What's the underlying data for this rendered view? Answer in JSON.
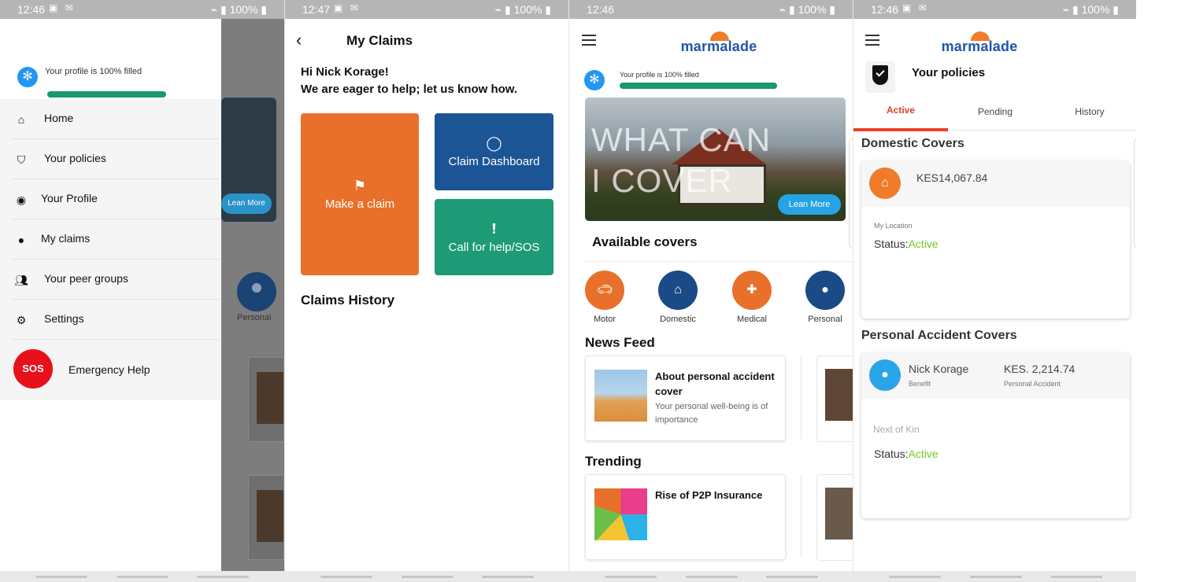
{
  "screens": {
    "drawer": {
      "status": {
        "time": "12:46",
        "battery": "100%"
      },
      "profile_progress_text": "Your profile is 100%  filled",
      "profile_progress": 1.0,
      "menu": [
        {
          "label": "Home",
          "icon": "home-icon"
        },
        {
          "label": "Your policies",
          "icon": "shield-icon"
        },
        {
          "label": "Your Profile",
          "icon": "profile-icon"
        },
        {
          "label": "My claims",
          "icon": "claims-icon"
        },
        {
          "label": "Your peer groups",
          "icon": "peer-groups-icon"
        },
        {
          "label": "Settings",
          "icon": "settings-icon"
        }
      ],
      "sos": {
        "badge": "SOS",
        "label": "Emergency Help"
      },
      "background": {
        "learn_more": "Lean More",
        "personal": "Personal"
      }
    },
    "claims": {
      "status": {
        "time": "12:47",
        "battery": "100%"
      },
      "title": "My Claims",
      "greeting": "Hi Nick Korage!",
      "subtitle": "We are eager to help; let us know how.",
      "tiles": {
        "make_claim": "Make a claim",
        "dashboard": "Claim Dashboard",
        "help": "Call for help/SOS"
      },
      "history_title": "Claims History"
    },
    "home": {
      "status": {
        "time": "12:46",
        "battery": "100%"
      },
      "logo": "marmalade",
      "profile_progress_text": "Your profile is 100% filled",
      "profile_progress": 1.0,
      "hero": {
        "line1": "WHAT CAN",
        "line2": "I COVER",
        "button": "Lean More"
      },
      "available_title": "Available covers",
      "covers": [
        {
          "label": "Motor",
          "color": "#e8702a",
          "icon": "car-icon"
        },
        {
          "label": "Domestic",
          "color": "#1b4b86",
          "icon": "house-icon"
        },
        {
          "label": "Medical",
          "color": "#e8702a",
          "icon": "medical-icon"
        },
        {
          "label": "Personal",
          "color": "#1b4b86",
          "icon": "person-icon"
        }
      ],
      "news_title": "News Feed",
      "news": {
        "title": "About personal accident cover",
        "desc": "Your personal well-being is of importance"
      },
      "trending_title": "Trending",
      "trending": {
        "title": "Rise of P2P Insurance"
      }
    },
    "policies": {
      "status": {
        "time": "12:46",
        "battery": "100%"
      },
      "logo": "marmalade",
      "title": "Your policies",
      "tabs": [
        "Active",
        "Pending",
        "History"
      ],
      "active_tab": "Active",
      "domestic": {
        "section": "Domestic Covers",
        "amount": "KES14,067.84",
        "location": "My Location",
        "status_label": "Status:",
        "status_value": "Active"
      },
      "personal": {
        "section": "Personal Accident Covers",
        "name": "Nick Korage",
        "name_sub": "Benefit",
        "amount": "KES. 2,214.74",
        "amount_sub": "Personal Accident",
        "kin": "Next of Kin",
        "status_label": "Status:",
        "status_value": "Active"
      }
    }
  }
}
